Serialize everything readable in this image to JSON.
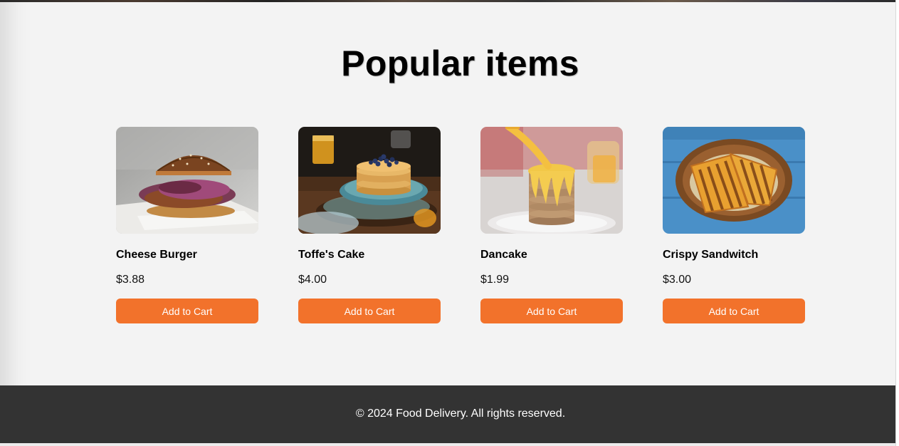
{
  "section": {
    "title": "Popular items"
  },
  "products": [
    {
      "name": "Cheese Burger",
      "price": "$3.88",
      "button_label": "Add to Cart",
      "image": "burger-photo"
    },
    {
      "name": "Toffe's Cake",
      "price": "$4.00",
      "button_label": "Add to Cart",
      "image": "pancake-stack-blueberries-photo"
    },
    {
      "name": "Dancake",
      "price": "$1.99",
      "button_label": "Add to Cart",
      "image": "pancake-stack-syrup-photo"
    },
    {
      "name": "Crispy Sandwitch",
      "price": "$3.00",
      "button_label": "Add to Cart",
      "image": "grilled-sandwich-photo"
    }
  ],
  "footer": {
    "text": "© 2024 Food Delivery. All rights reserved."
  },
  "colors": {
    "accent": "#f2722b",
    "section_background": "#f3f3f3",
    "footer_background": "#333333"
  }
}
